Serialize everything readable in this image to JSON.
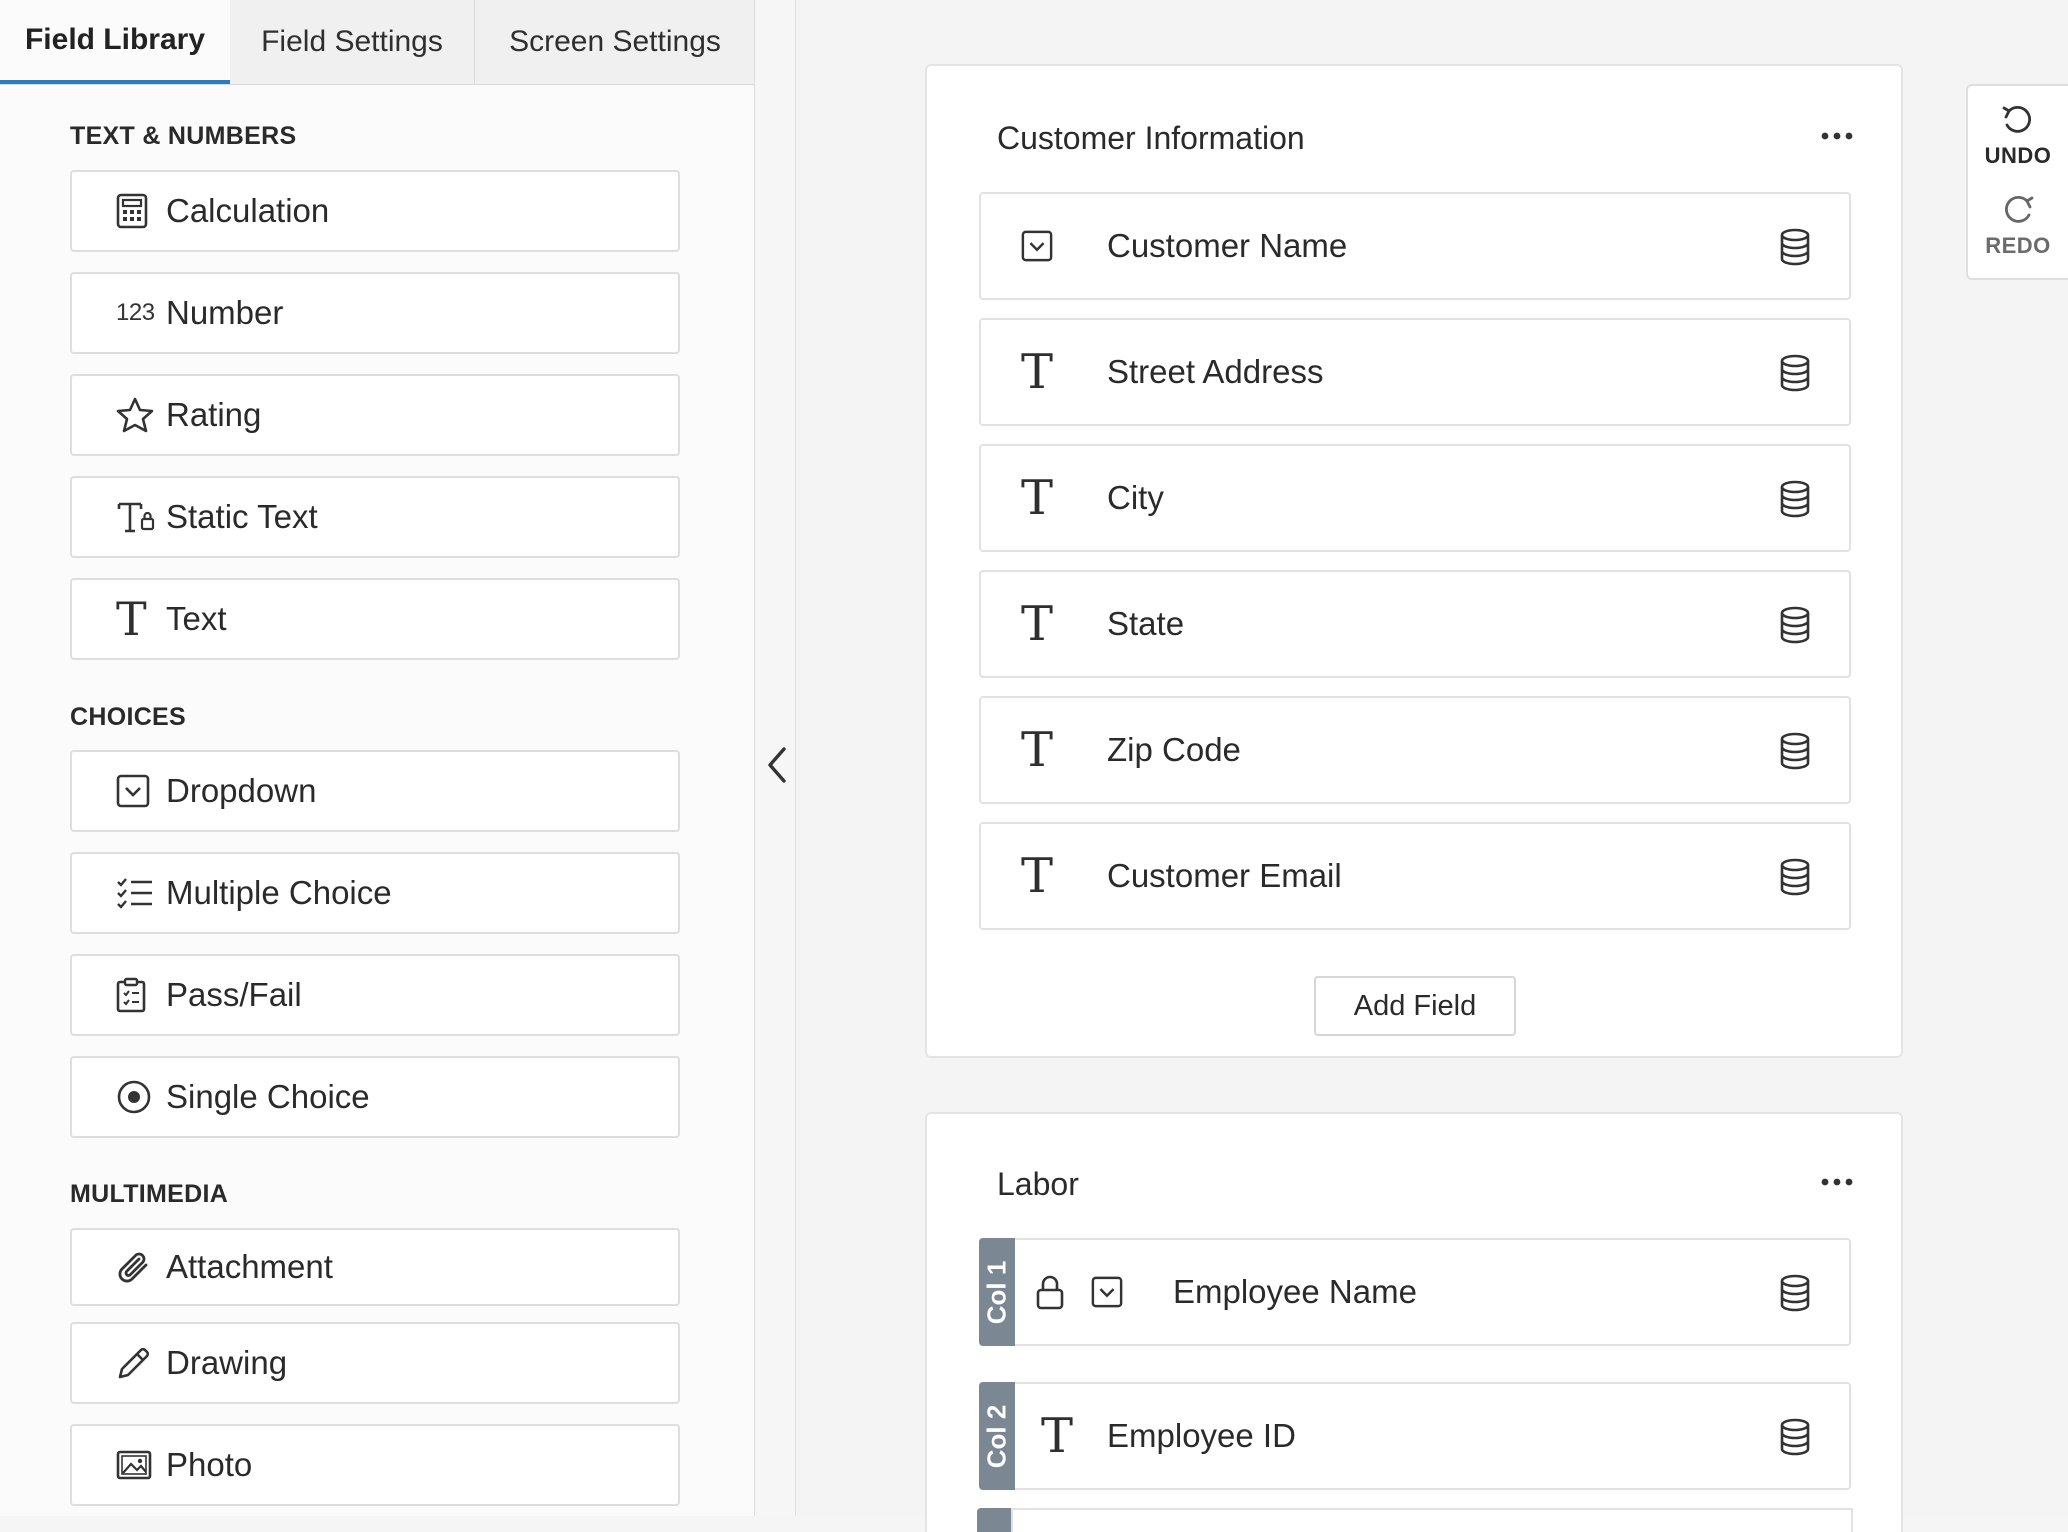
{
  "tabs": [
    "Field Library",
    "Field Settings",
    "Screen Settings"
  ],
  "library": {
    "sections": [
      {
        "label": "TEXT & NUMBERS",
        "items": [
          {
            "label": "Calculation",
            "icon": "calculator-icon"
          },
          {
            "label": "Number",
            "icon": "number-icon",
            "icon_text": "123"
          },
          {
            "label": "Rating",
            "icon": "star-icon"
          },
          {
            "label": "Static Text",
            "icon": "static-text-icon"
          },
          {
            "label": "Text",
            "icon": "text-icon"
          }
        ]
      },
      {
        "label": "CHOICES",
        "items": [
          {
            "label": "Dropdown",
            "icon": "dropdown-icon"
          },
          {
            "label": "Multiple Choice",
            "icon": "checklist-icon"
          },
          {
            "label": "Pass/Fail",
            "icon": "clipboard-icon"
          },
          {
            "label": "Single Choice",
            "icon": "radio-icon"
          }
        ]
      },
      {
        "label": "MULTIMEDIA",
        "items": [
          {
            "label": "Attachment",
            "icon": "paperclip-icon"
          },
          {
            "label": "Drawing",
            "icon": "pencil-icon"
          },
          {
            "label": "Photo",
            "icon": "image-icon"
          }
        ]
      }
    ]
  },
  "cards": [
    {
      "title": "Customer Information",
      "fields": [
        {
          "label": "Customer Name",
          "icon": "dropdown-icon"
        },
        {
          "label": "Street Address",
          "icon": "text-icon"
        },
        {
          "label": "City",
          "icon": "text-icon"
        },
        {
          "label": "State",
          "icon": "text-icon"
        },
        {
          "label": "Zip Code",
          "icon": "text-icon"
        },
        {
          "label": "Customer Email",
          "icon": "text-icon"
        }
      ],
      "add_label": "Add Field"
    },
    {
      "title": "Labor",
      "fields": [
        {
          "label": "Employee Name",
          "icon": "dropdown-icon",
          "locked": true,
          "column": "Col 1"
        },
        {
          "label": "Employee ID",
          "icon": "text-icon",
          "column": "Col 2"
        }
      ]
    }
  ],
  "history": {
    "undo": "UNDO",
    "redo": "REDO"
  },
  "text_glyph": "T",
  "colors": {
    "accent": "#2b7bbf",
    "col_tag": "#7b8793"
  }
}
